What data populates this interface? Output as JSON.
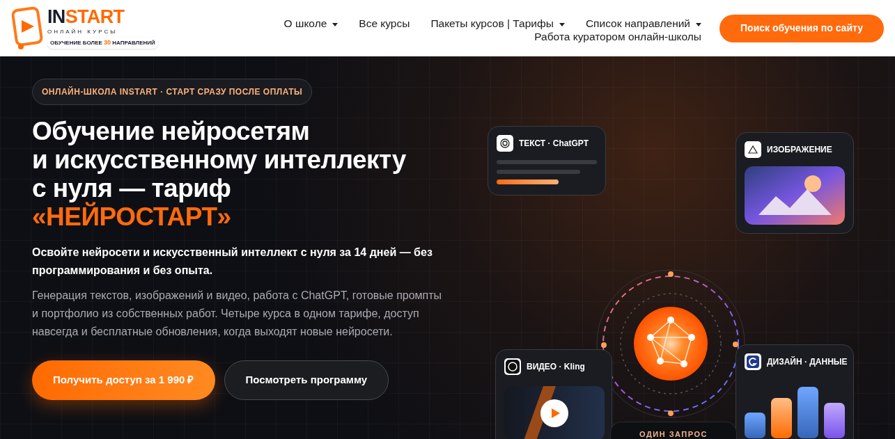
{
  "logo": {
    "word_dark": "IN",
    "word_accent": "START",
    "subtitle": "ОНЛАЙН КУРСЫ",
    "badge": [
      "ОБУЧЕНИЕ БОЛЕЕ",
      "30",
      "НАПРАВЛЕНИЙ"
    ]
  },
  "nav": [
    {
      "label": "О школе",
      "dropdown": true
    },
    {
      "label": "Все курсы",
      "dropdown": false
    },
    {
      "label": "Пакеты курсов | Тарифы",
      "dropdown": true
    },
    {
      "label": "Список направлений",
      "dropdown": true
    },
    {
      "label": "Работа куратором онлайн-школы",
      "dropdown": false
    }
  ],
  "search_button": "Поиск обучения по сайту",
  "hero": {
    "eyebrow": "ОНЛАЙН-ШКОЛА INSTART · СТАРТ СРАЗУ ПОСЛЕ ОПЛАТЫ",
    "title_lines": [
      "Обучение нейросетям",
      "и искусственному интеллекту",
      "с нуля — тариф"
    ],
    "title_accent": "«НЕЙРОСТАРТ»",
    "lead": "Освойте нейросети и искусственный интеллект с нуля за 14 дней — без программирования и без опыта.",
    "description": "Генерация текстов, изображений и видео, работа с ChatGPT, готовые промпты и портфолио из собственных работ. Четыре курса в одном тарифе, доступ навсегда и бесплатные обновления, когда выходят новые нейросети.",
    "buttons": [
      {
        "label": "Получить доступ за 1 990 ₽",
        "kind": "primary"
      },
      {
        "label": "Посмотреть программу",
        "kind": "secondary"
      }
    ]
  },
  "cards": [
    {
      "title": "ТЕКСТ · ChatGPT",
      "kind": "text"
    },
    {
      "title": "ИЗОБРАЖЕНИЕ",
      "kind": "image"
    },
    {
      "title": "ВИДЕО · Kling",
      "kind": "video"
    },
    {
      "title": "ДИЗАЙН · ДАННЫЕ",
      "kind": "chart"
    }
  ],
  "bottom_tag": "ОДИН ЗАПРОС"
}
